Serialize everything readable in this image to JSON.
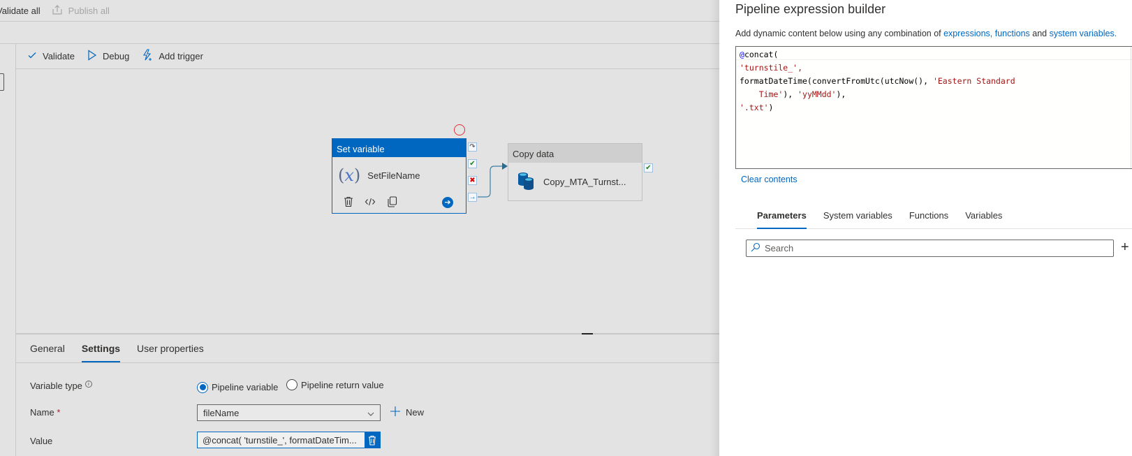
{
  "topbar": {
    "validate_all": "Validate all",
    "publish_all": "Publish all"
  },
  "toolbar": {
    "validate": "Validate",
    "debug": "Debug",
    "add_trigger": "Add trigger"
  },
  "canvas": {
    "set_variable": {
      "header": "Set variable",
      "name": "SetFileName",
      "icon": "variable-x-icon"
    },
    "copy_data": {
      "header": "Copy data",
      "name": "Copy_MTA_Turnst...",
      "icon": "database-icon"
    }
  },
  "props": {
    "tabs": [
      {
        "label": "General",
        "active": false
      },
      {
        "label": "Settings",
        "active": true
      },
      {
        "label": "User properties",
        "active": false
      }
    ],
    "variable_type_label": "Variable type",
    "variable_type_options": [
      {
        "label": "Pipeline variable",
        "checked": true
      },
      {
        "label": "Pipeline return value",
        "checked": false
      }
    ],
    "name_label": "Name",
    "name_required": "*",
    "name_value": "fileName",
    "new_label": "New",
    "value_label": "Value",
    "value_text": "@concat( 'turnstile_', formatDateTim..."
  },
  "builder": {
    "title": "Pipeline expression builder",
    "desc_prefix": "Add dynamic content below using any combination of ",
    "desc_link1": "expressions, functions",
    "desc_mid": " and ",
    "desc_link2": "system variables.",
    "expression_lines": [
      "@concat(",
      "'turnstile_',",
      "formatDateTime(convertFromUtc(utcNow(), 'Eastern Standard",
      "    Time'), 'yyMMdd'),",
      "'.txt')"
    ],
    "clear_contents": "Clear contents",
    "tabs": [
      {
        "label": "Parameters",
        "active": true
      },
      {
        "label": "System variables",
        "active": false
      },
      {
        "label": "Functions",
        "active": false
      },
      {
        "label": "Variables",
        "active": false
      }
    ],
    "search_placeholder": "Search"
  },
  "colors": {
    "accent": "#0067c0",
    "string_literal": "#a31515",
    "error": "#e3303a",
    "success": "#208020"
  }
}
